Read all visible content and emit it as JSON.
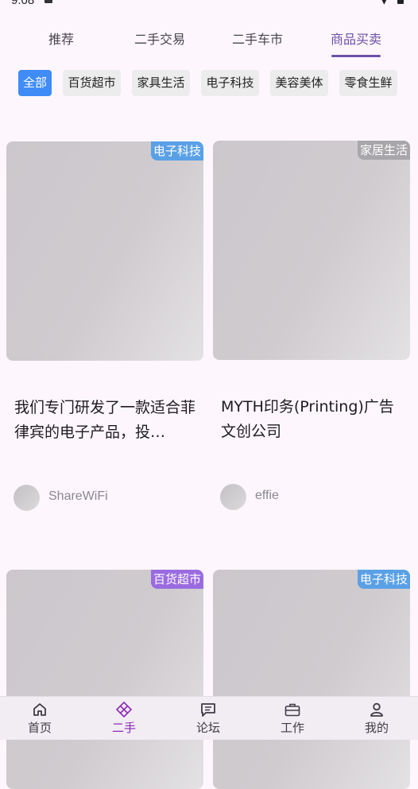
{
  "status": {
    "time": "9:08"
  },
  "tabs": [
    {
      "label": "推荐"
    },
    {
      "label": "二手交易"
    },
    {
      "label": "二手车市"
    },
    {
      "label": "商品买卖"
    }
  ],
  "chips": [
    {
      "label": "全部"
    },
    {
      "label": "百货超市"
    },
    {
      "label": "家具生活"
    },
    {
      "label": "电子科技"
    },
    {
      "label": "美容美体"
    },
    {
      "label": "零食生鲜"
    }
  ],
  "cards": [
    {
      "tag": "电子科技",
      "title": "我们专门研发了一款适合菲律宾的电子产品，投…",
      "user": "ShareWiFi"
    },
    {
      "tag": "家居生活",
      "title": "MYTH印务(Printing)广告文创公司",
      "user": "effie"
    },
    {
      "tag": "百货超市"
    },
    {
      "tag": "电子科技"
    }
  ],
  "bottom_nav": [
    {
      "label": "首页",
      "icon": "home-icon"
    },
    {
      "label": "二手",
      "icon": "diamond-grid-icon"
    },
    {
      "label": "论坛",
      "icon": "chat-icon"
    },
    {
      "label": "工作",
      "icon": "briefcase-icon"
    },
    {
      "label": "我的",
      "icon": "person-icon"
    }
  ],
  "colors": {
    "accent": "#3f8cf7",
    "tab_active": "#6b4fa5",
    "nav_active": "#8a2bb8",
    "tag_blue": "#5aa0e6",
    "tag_gray": "#a9a6ab",
    "tag_purple": "#9a6be0"
  }
}
